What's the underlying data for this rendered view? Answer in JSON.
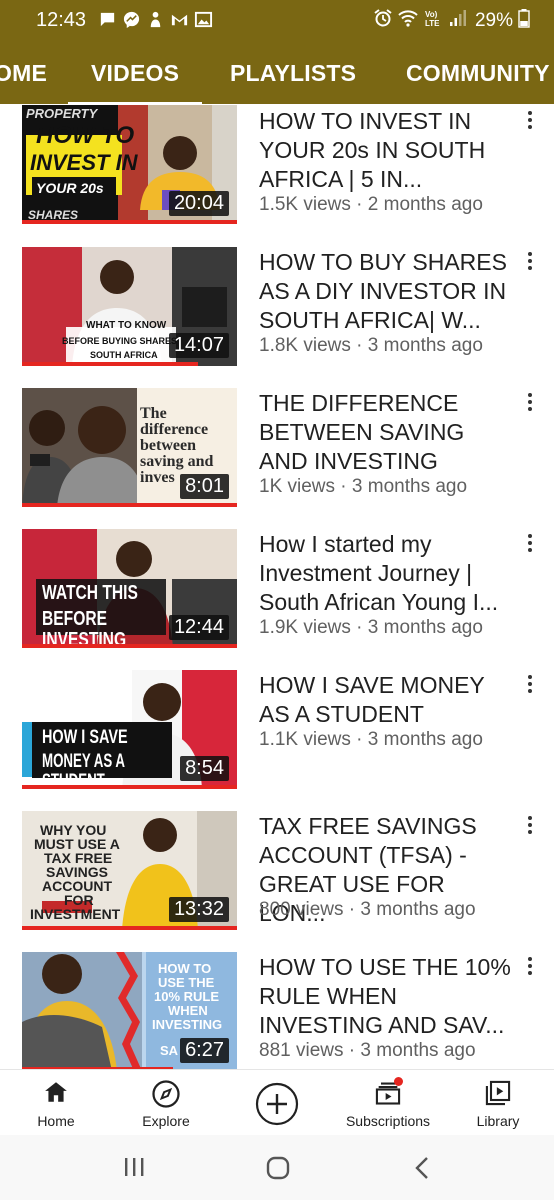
{
  "status_bar": {
    "time": "12:43",
    "left_icons": [
      "chat-icon",
      "messenger-icon",
      "app-icon",
      "gmail-icon",
      "gallery-icon"
    ],
    "right_icons": [
      "alarm-icon",
      "wifi-icon",
      "volte-icon",
      "signal-icon"
    ],
    "battery": "29%"
  },
  "tabs": {
    "prev": "OME",
    "videos": "VIDEOS",
    "playlists": "PLAYLISTS",
    "community": "COMMUNITY",
    "active": "VIDEOS"
  },
  "thumb_texts": {
    "t1_top": "PROPERTY",
    "t1_line1": "HOW TO",
    "t1_line2": "INVEST IN",
    "t1_line3": "YOUR 20s",
    "t1_bottom": "SHARES",
    "t2_line1": "WHAT TO KNOW",
    "t2_line2": "BEFORE BUYING SHARES",
    "t2_line3": "SOUTH AFRICA",
    "t3_line1": "The",
    "t3_line2": "difference",
    "t3_line3": "between",
    "t3_line4": "saving and",
    "t3_line5": "inves",
    "t4_line1": "WATCH THIS",
    "t4_line2": "BEFORE INVESTING",
    "t5_line1": "HOW I SAVE",
    "t5_line2": "MONEY AS A STUDENT",
    "t6_line1": "WHY YOU",
    "t6_line2": "MUST USE A",
    "t6_line3": "TAX FREE",
    "t6_line4": "SAVINGS",
    "t6_line5": "ACCOUNT",
    "t6_line6": "FOR",
    "t6_line7": "INVESTMENT",
    "t7_line1": "HOW TO",
    "t7_line2": "USE THE",
    "t7_line3": "10% RULE",
    "t7_line4": "WHEN",
    "t7_line5": "INVESTING",
    "t7_line6": "SA"
  },
  "videos": [
    {
      "title": "HOW TO INVEST IN YOUR 20s IN SOUTH AFRICA | 5 IN...",
      "views": "1.5K views",
      "age": "2 months ago",
      "duration": "20:04"
    },
    {
      "title": "HOW TO BUY SHARES AS A DIY INVESTOR IN SOUTH AFRICA| W...",
      "views": "1.8K views",
      "age": "3 months ago",
      "duration": "14:07"
    },
    {
      "title": "THE DIFFERENCE BETWEEN SAVING AND INVESTING",
      "views": "1K views",
      "age": "3 months ago",
      "duration": "8:01"
    },
    {
      "title": "How I started my Investment Journey | South African Young I...",
      "views": "1.9K views",
      "age": "3 months ago",
      "duration": "12:44"
    },
    {
      "title": "HOW I SAVE MONEY AS A STUDENT",
      "views": "1.1K views",
      "age": "3 months ago",
      "duration": "8:54"
    },
    {
      "title": "TAX FREE SAVINGS ACCOUNT (TFSA) - GREAT USE FOR LON...",
      "views": "800 views",
      "age": "3 months ago",
      "duration": "13:32"
    },
    {
      "title": "HOW TO USE THE 10% RULE WHEN INVESTING AND SAV...",
      "views": "881 views",
      "age": "3 months ago",
      "duration": "6:27"
    }
  ],
  "bottom_nav": {
    "home": "Home",
    "explore": "Explore",
    "create": "",
    "subscriptions": "Subscriptions",
    "library": "Library",
    "active": "Home"
  },
  "colors": {
    "header_bg": "#7a6713",
    "progress_red": "#e52620",
    "meta_gray": "#606060"
  },
  "system_nav": [
    "recents-icon",
    "home-circle-icon",
    "back-icon"
  ]
}
